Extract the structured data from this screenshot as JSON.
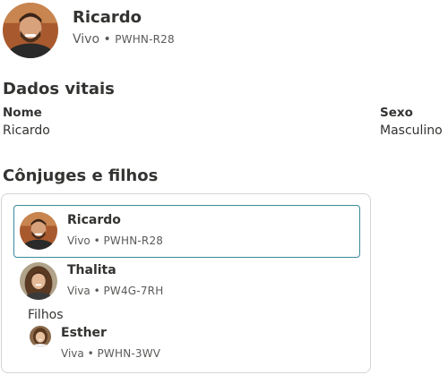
{
  "header": {
    "name": "Ricardo",
    "status": "Vivo",
    "separator": "•",
    "person_id": "PWHN-R28"
  },
  "vitals": {
    "title": "Dados vitais",
    "name_label": "Nome",
    "name_value": "Ricardo",
    "sex_label": "Sexo",
    "sex_value": "Masculino"
  },
  "family": {
    "title": "Cônjuges e filhos",
    "members": [
      {
        "name": "Ricardo",
        "status": "Vivo",
        "person_id": "PWHN-R28",
        "selected": true
      },
      {
        "name": "Thalita",
        "status": "Viva",
        "person_id": "PW4G-7RH"
      }
    ],
    "children_label": "Filhos",
    "children": [
      {
        "name": "Esther",
        "status": "Viva",
        "person_id": "PWHN-3WV"
      }
    ]
  },
  "colors": {
    "text": "#333331",
    "muted": "#5a5a58",
    "selected_border": "#3a8a9a",
    "card_border": "#d4d4d2"
  }
}
